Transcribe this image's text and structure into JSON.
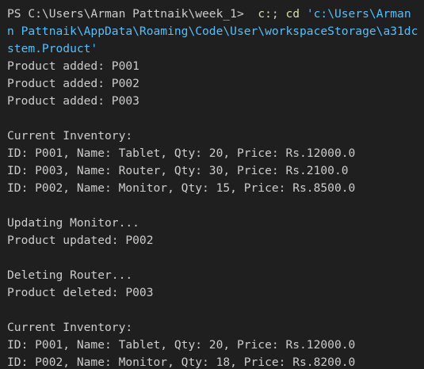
{
  "terminal": {
    "prompt": "PS C:\\Users\\Arman Pattnaik\\week_1> ",
    "command": {
      "part1": " c:",
      "part2": "; ",
      "part3": "cd",
      "part4": " 'c:\\Users\\Arman"
    },
    "wrapped": [
      "n Pattnaik\\AppData\\Roaming\\Code\\User\\workspaceStorage\\a31dc",
      "stem.Product'"
    ],
    "output": [
      "Product added: P001",
      "Product added: P002",
      "Product added: P003",
      "",
      "Current Inventory:",
      "ID: P001, Name: Tablet, Qty: 20, Price: Rs.12000.0",
      "ID: P003, Name: Router, Qty: 30, Price: Rs.2100.0",
      "ID: P002, Name: Monitor, Qty: 15, Price: Rs.8500.0",
      "",
      "Updating Monitor...",
      "Product updated: P002",
      "",
      "Deleting Router...",
      "Product deleted: P003",
      "",
      "Current Inventory:",
      "ID: P001, Name: Tablet, Qty: 20, Price: Rs.12000.0",
      "ID: P002, Name: Monitor, Qty: 18, Price: Rs.8200.0"
    ]
  }
}
